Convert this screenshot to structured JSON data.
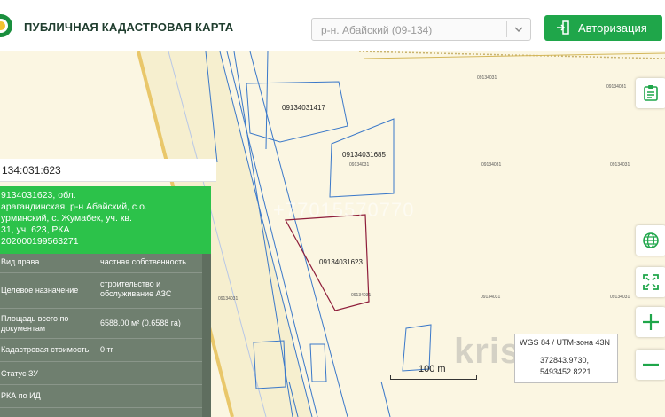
{
  "header": {
    "title": "ПУБЛИЧНАЯ КАДАСТРОВАЯ КАРТА",
    "region_value": "р-н. Абайский (09-134)",
    "auth_label": "Авторизация"
  },
  "map": {
    "parcels": [
      {
        "label": "09134031417",
        "sub": ""
      },
      {
        "label": "09134031685",
        "sub": "09134031"
      },
      {
        "label": "09134031623",
        "sub": "09134031"
      }
    ],
    "tiny_labels": [
      "09134031",
      "09134031",
      "09134031",
      "09134031",
      "09134031",
      "09134031",
      "09134031"
    ],
    "watermark_number": "+77015570770",
    "watermark_site": "krisha.kz",
    "scale_label": "100 m",
    "crs": "WGS 84 / UTM-зона 43N",
    "coord_x": "372843.9730,",
    "coord_y": "5493452.8221"
  },
  "panel": {
    "search_value": "134:031:623",
    "info_lines": [
      "9134031623, обл.",
      "арагандинская, р-н Абайский, с.о.",
      "урминский, с. Жумабек, уч. кв.",
      "31, уч. 623, РКА",
      "202000199563271"
    ],
    "rows": [
      {
        "key": "Вид права",
        "value": "частная собственность"
      },
      {
        "key": "Целевое назначение",
        "value": "строительство и обслуживание АЗС"
      },
      {
        "key": "Площадь всего по документам",
        "value": "6588.00 м² (0.6588 га)"
      },
      {
        "key": "Кадастровая стоимость",
        "value": "0 тг"
      },
      {
        "key": "Статус ЗУ",
        "value": ""
      },
      {
        "key": "РКА по ИД",
        "value": ""
      }
    ]
  },
  "icons": {
    "logo": "kz-emblem-logo",
    "region_chevron": "chevron-down-icon",
    "auth": "login-icon",
    "doc": "document-list-icon",
    "globe": "globe-icon",
    "fullscreen": "fullscreen-icon",
    "zoom_in": "plus-icon",
    "zoom_out": "minus-icon"
  },
  "colors": {
    "accent_green": "#1fa64a",
    "panel_green": "#2cc24a",
    "panel_table": "#6f7f6f",
    "map_bg": "#fbf6e2",
    "parcel_outline": "#3a78c9",
    "selected_outline": "#8e1d3a"
  }
}
